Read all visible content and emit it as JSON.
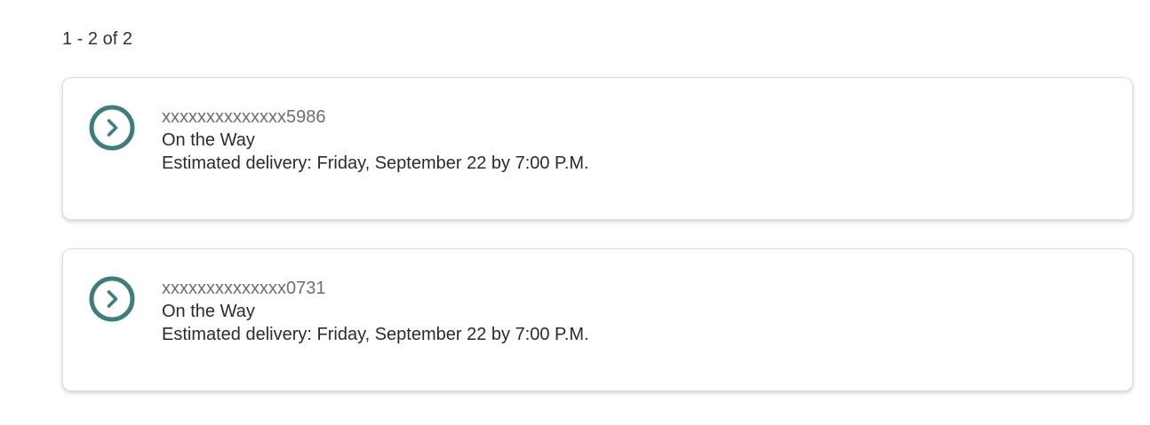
{
  "results": {
    "count_label": "1 - 2 of 2"
  },
  "colors": {
    "accent": "#3f7c7a"
  },
  "shipments": [
    {
      "icon": "chevron-right-circle-icon",
      "tracking": "xxxxxxxxxxxxxx5986",
      "status": "On the Way",
      "eta": "Estimated delivery: Friday, September 22 by 7:00 P.M."
    },
    {
      "icon": "chevron-right-circle-icon",
      "tracking": "xxxxxxxxxxxxxx0731",
      "status": "On the Way",
      "eta": "Estimated delivery: Friday, September 22 by 7:00 P.M."
    }
  ]
}
